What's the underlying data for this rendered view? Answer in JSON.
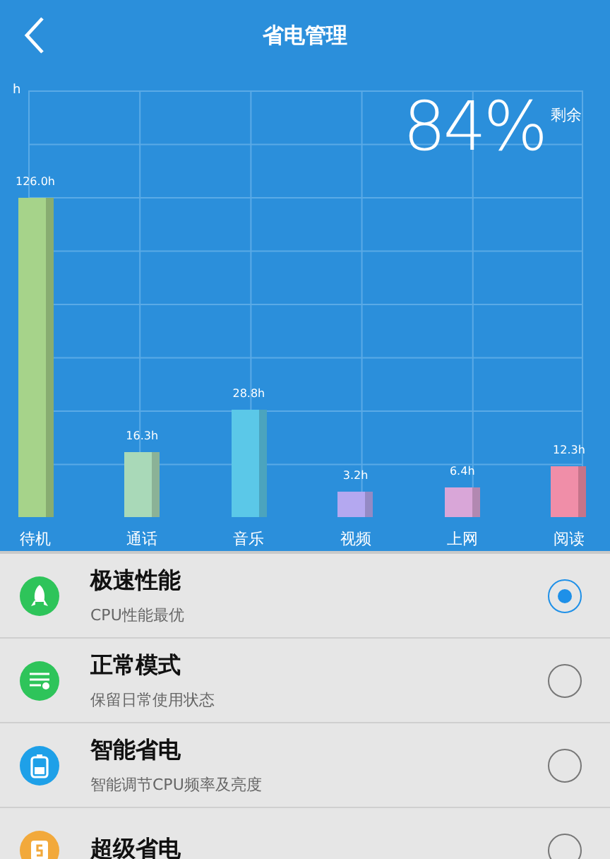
{
  "header": {
    "title": "省电管理"
  },
  "battery": {
    "percent": "84%",
    "label": "剩余"
  },
  "usage": {
    "unit": "h",
    "bars": [
      {
        "category": "待机",
        "value": "126.0h",
        "color": "#a6d38a"
      },
      {
        "category": "通话",
        "value": "16.3h",
        "color": "#a9d9b8"
      },
      {
        "category": "音乐",
        "value": "28.8h",
        "color": "#5bc8e8"
      },
      {
        "category": "视频",
        "value": "3.2h",
        "color": "#b4a8f0"
      },
      {
        "category": "上网",
        "value": "6.4h",
        "color": "#d9a6d8"
      },
      {
        "category": "阅读",
        "value": "12.3h",
        "color": "#f08ea8"
      }
    ]
  },
  "modes": [
    {
      "kind": "rocket",
      "color": "#2ec45a",
      "title": "极速性能",
      "subtitle": "CPU性能最优",
      "selected": true
    },
    {
      "kind": "list",
      "color": "#2ec45a",
      "title": "正常模式",
      "subtitle": "保留日常使用状态",
      "selected": false
    },
    {
      "kind": "battery",
      "color": "#1ea0e8",
      "title": "智能省电",
      "subtitle": "智能调节CPU频率及亮度",
      "selected": false
    },
    {
      "kind": "coin",
      "color": "#f2a93b",
      "title": "超级省电",
      "selected": false
    }
  ]
}
